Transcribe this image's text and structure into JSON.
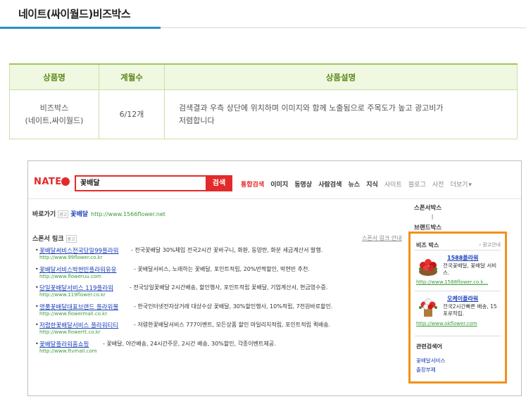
{
  "page": {
    "title": "네이트(싸이월드)비즈박스"
  },
  "table": {
    "headers": [
      "상품명",
      "계월수",
      "상품설명"
    ],
    "row": {
      "name_line1": "비즈박스",
      "name_line2": "(네이트,싸이월드)",
      "months": "6/12개",
      "desc_line1": "검색결과 우측 상단에 위치하며 이미지와 함께 노출됨으로 주목도가 높고 광고비가",
      "desc_line2": "저렴합니다"
    }
  },
  "nate": {
    "logo": "NATE",
    "search_value": "꽃배달",
    "search_button": "검색",
    "tabs": [
      "통합검색",
      "이미지",
      "동영상",
      "사람검색",
      "뉴스",
      "지식",
      "사이트",
      "블로그",
      "사전",
      "더보기"
    ],
    "shortcut": {
      "label": "바로가기",
      "badge": "광고",
      "link": "꽃배달",
      "url": "http://www.1566flower.net"
    },
    "sponsor_title": "스폰서 링크",
    "sponsor_badge": "광고",
    "sponsor_right": "스폰서 링크 안내",
    "sponsor_items": [
      {
        "name": "꽃배달써비스전국당일99플라워",
        "desc": "- 전국꽃배달 30%체입 전국2시간 꽃바구니, 화환, 동양란, 화분 세금계산서 발행.",
        "url": "http://www.99flower.co.kr"
      },
      {
        "name": "꽃배달서비스박현빈플라워유유",
        "desc": "- 꽃배달서비스, 노래하는 꽃배달, 포인트적립, 20%반짝할인, 박현빈 추천.",
        "url": "http://www.floweruu.com"
      },
      {
        "name": "당일꽃배달서비스 119플라워",
        "desc": "- 전국당일꽃배달 2시간배송, 할인행사, 포인트적립 꽃배달, 기업계산서, 현금영수증.",
        "url": "http://www.119flower.co.kr"
      },
      {
        "name": "명품꽃배달대표브랜드 플라워몰",
        "desc": "- 한국인터넷전자상거래 대상수상 꽃배달, 30%할인행사, 10%적립, 7천원바로할인.",
        "url": "http://www.flowermall.co.kr"
      },
      {
        "name": "저렴한꽃배달서비스 플라워티티",
        "desc": "- 저렴한꽃배달서비스 777이벤트, 모든상품 할인 마일리지적립, 포인트적립 퀵배송.",
        "url": "http://www.flowertt.co.kr"
      },
      {
        "name": "꽃배달플라워홈쇼핑",
        "desc": "- 꽃배달, 야간배송, 24시간주문, 2시간 배송, 30%할인, 각종이벤트제공.",
        "url": "http://www.ftvmall.com"
      }
    ],
    "right_col": [
      "스폰서박스",
      "브랜드박스"
    ],
    "bizbox": {
      "title": "비즈 박스",
      "guide": "› 광고안내",
      "items": [
        {
          "name": "1588플라워",
          "text": "전국꽃배달, 꽃배달 서비스.",
          "url": "http://www.1588flower.co.k..."
        },
        {
          "name": "오케이플라워",
          "text": "전국2시간빠른 배송, 15포로적립.",
          "url": "http://www.okflower.com"
        }
      ],
      "related_title": "관련검색어",
      "related": [
        "꽃배달서비스",
        "출장부페"
      ]
    }
  }
}
